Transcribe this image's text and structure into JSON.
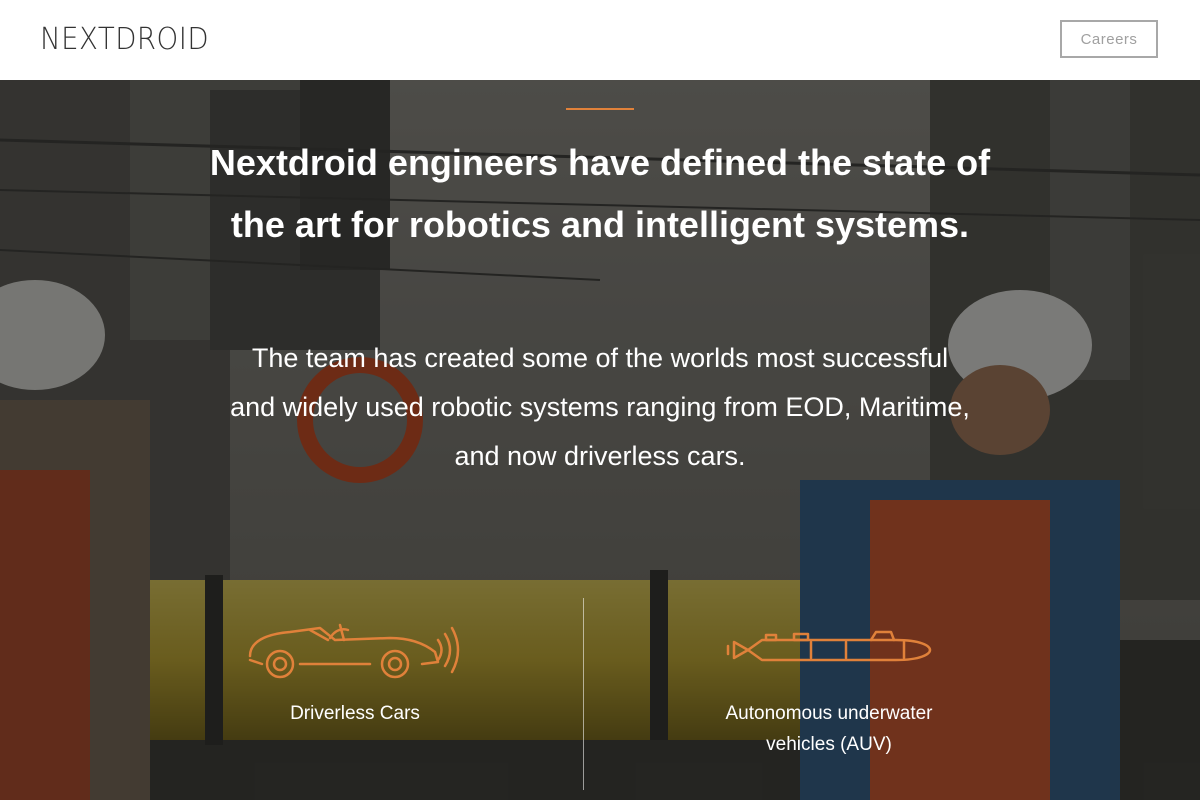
{
  "header": {
    "logo": "NEXTDROID",
    "careers_label": "Careers"
  },
  "hero": {
    "headline": "Nextdroid engineers have defined the state of the art for robotics and intelligent systems.",
    "subtext": "The team has created some of the worlds most successful and widely used robotic systems ranging from EOD, Maritime, and now driverless cars."
  },
  "features": [
    {
      "label": "Driverless Cars",
      "icon": "car-icon"
    },
    {
      "label": "Autonomous underwater vehicles (AUV)",
      "icon": "submarine-icon"
    }
  ],
  "colors": {
    "accent": "#e0813a",
    "header_bg": "#ffffff",
    "text": "#ffffff"
  }
}
